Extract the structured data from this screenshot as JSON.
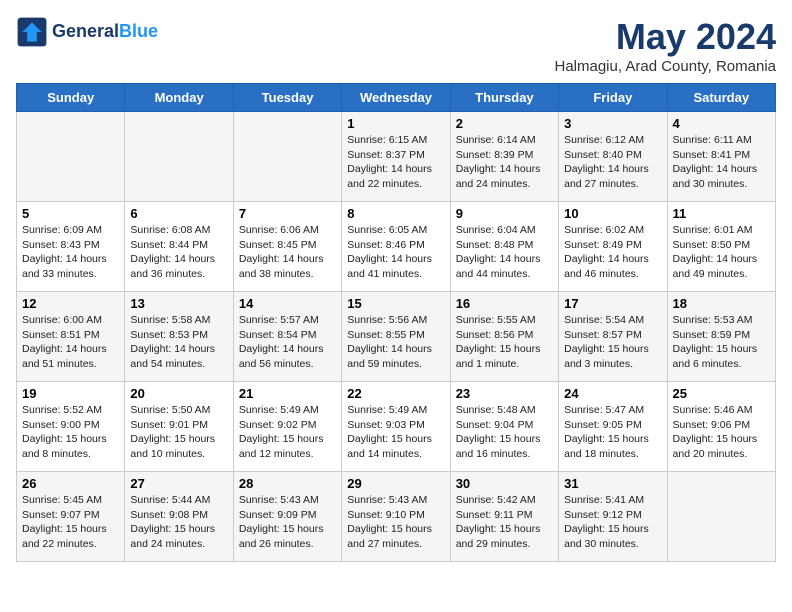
{
  "header": {
    "logo_line1": "General",
    "logo_line2": "Blue",
    "month": "May 2024",
    "location": "Halmagiu, Arad County, Romania"
  },
  "weekdays": [
    "Sunday",
    "Monday",
    "Tuesday",
    "Wednesday",
    "Thursday",
    "Friday",
    "Saturday"
  ],
  "weeks": [
    [
      {
        "day": "",
        "text": ""
      },
      {
        "day": "",
        "text": ""
      },
      {
        "day": "",
        "text": ""
      },
      {
        "day": "1",
        "text": "Sunrise: 6:15 AM\nSunset: 8:37 PM\nDaylight: 14 hours\nand 22 minutes."
      },
      {
        "day": "2",
        "text": "Sunrise: 6:14 AM\nSunset: 8:39 PM\nDaylight: 14 hours\nand 24 minutes."
      },
      {
        "day": "3",
        "text": "Sunrise: 6:12 AM\nSunset: 8:40 PM\nDaylight: 14 hours\nand 27 minutes."
      },
      {
        "day": "4",
        "text": "Sunrise: 6:11 AM\nSunset: 8:41 PM\nDaylight: 14 hours\nand 30 minutes."
      }
    ],
    [
      {
        "day": "5",
        "text": "Sunrise: 6:09 AM\nSunset: 8:43 PM\nDaylight: 14 hours\nand 33 minutes."
      },
      {
        "day": "6",
        "text": "Sunrise: 6:08 AM\nSunset: 8:44 PM\nDaylight: 14 hours\nand 36 minutes."
      },
      {
        "day": "7",
        "text": "Sunrise: 6:06 AM\nSunset: 8:45 PM\nDaylight: 14 hours\nand 38 minutes."
      },
      {
        "day": "8",
        "text": "Sunrise: 6:05 AM\nSunset: 8:46 PM\nDaylight: 14 hours\nand 41 minutes."
      },
      {
        "day": "9",
        "text": "Sunrise: 6:04 AM\nSunset: 8:48 PM\nDaylight: 14 hours\nand 44 minutes."
      },
      {
        "day": "10",
        "text": "Sunrise: 6:02 AM\nSunset: 8:49 PM\nDaylight: 14 hours\nand 46 minutes."
      },
      {
        "day": "11",
        "text": "Sunrise: 6:01 AM\nSunset: 8:50 PM\nDaylight: 14 hours\nand 49 minutes."
      }
    ],
    [
      {
        "day": "12",
        "text": "Sunrise: 6:00 AM\nSunset: 8:51 PM\nDaylight: 14 hours\nand 51 minutes."
      },
      {
        "day": "13",
        "text": "Sunrise: 5:58 AM\nSunset: 8:53 PM\nDaylight: 14 hours\nand 54 minutes."
      },
      {
        "day": "14",
        "text": "Sunrise: 5:57 AM\nSunset: 8:54 PM\nDaylight: 14 hours\nand 56 minutes."
      },
      {
        "day": "15",
        "text": "Sunrise: 5:56 AM\nSunset: 8:55 PM\nDaylight: 14 hours\nand 59 minutes."
      },
      {
        "day": "16",
        "text": "Sunrise: 5:55 AM\nSunset: 8:56 PM\nDaylight: 15 hours\nand 1 minute."
      },
      {
        "day": "17",
        "text": "Sunrise: 5:54 AM\nSunset: 8:57 PM\nDaylight: 15 hours\nand 3 minutes."
      },
      {
        "day": "18",
        "text": "Sunrise: 5:53 AM\nSunset: 8:59 PM\nDaylight: 15 hours\nand 6 minutes."
      }
    ],
    [
      {
        "day": "19",
        "text": "Sunrise: 5:52 AM\nSunset: 9:00 PM\nDaylight: 15 hours\nand 8 minutes."
      },
      {
        "day": "20",
        "text": "Sunrise: 5:50 AM\nSunset: 9:01 PM\nDaylight: 15 hours\nand 10 minutes."
      },
      {
        "day": "21",
        "text": "Sunrise: 5:49 AM\nSunset: 9:02 PM\nDaylight: 15 hours\nand 12 minutes."
      },
      {
        "day": "22",
        "text": "Sunrise: 5:49 AM\nSunset: 9:03 PM\nDaylight: 15 hours\nand 14 minutes."
      },
      {
        "day": "23",
        "text": "Sunrise: 5:48 AM\nSunset: 9:04 PM\nDaylight: 15 hours\nand 16 minutes."
      },
      {
        "day": "24",
        "text": "Sunrise: 5:47 AM\nSunset: 9:05 PM\nDaylight: 15 hours\nand 18 minutes."
      },
      {
        "day": "25",
        "text": "Sunrise: 5:46 AM\nSunset: 9:06 PM\nDaylight: 15 hours\nand 20 minutes."
      }
    ],
    [
      {
        "day": "26",
        "text": "Sunrise: 5:45 AM\nSunset: 9:07 PM\nDaylight: 15 hours\nand 22 minutes."
      },
      {
        "day": "27",
        "text": "Sunrise: 5:44 AM\nSunset: 9:08 PM\nDaylight: 15 hours\nand 24 minutes."
      },
      {
        "day": "28",
        "text": "Sunrise: 5:43 AM\nSunset: 9:09 PM\nDaylight: 15 hours\nand 26 minutes."
      },
      {
        "day": "29",
        "text": "Sunrise: 5:43 AM\nSunset: 9:10 PM\nDaylight: 15 hours\nand 27 minutes."
      },
      {
        "day": "30",
        "text": "Sunrise: 5:42 AM\nSunset: 9:11 PM\nDaylight: 15 hours\nand 29 minutes."
      },
      {
        "day": "31",
        "text": "Sunrise: 5:41 AM\nSunset: 9:12 PM\nDaylight: 15 hours\nand 30 minutes."
      },
      {
        "day": "",
        "text": ""
      }
    ]
  ]
}
